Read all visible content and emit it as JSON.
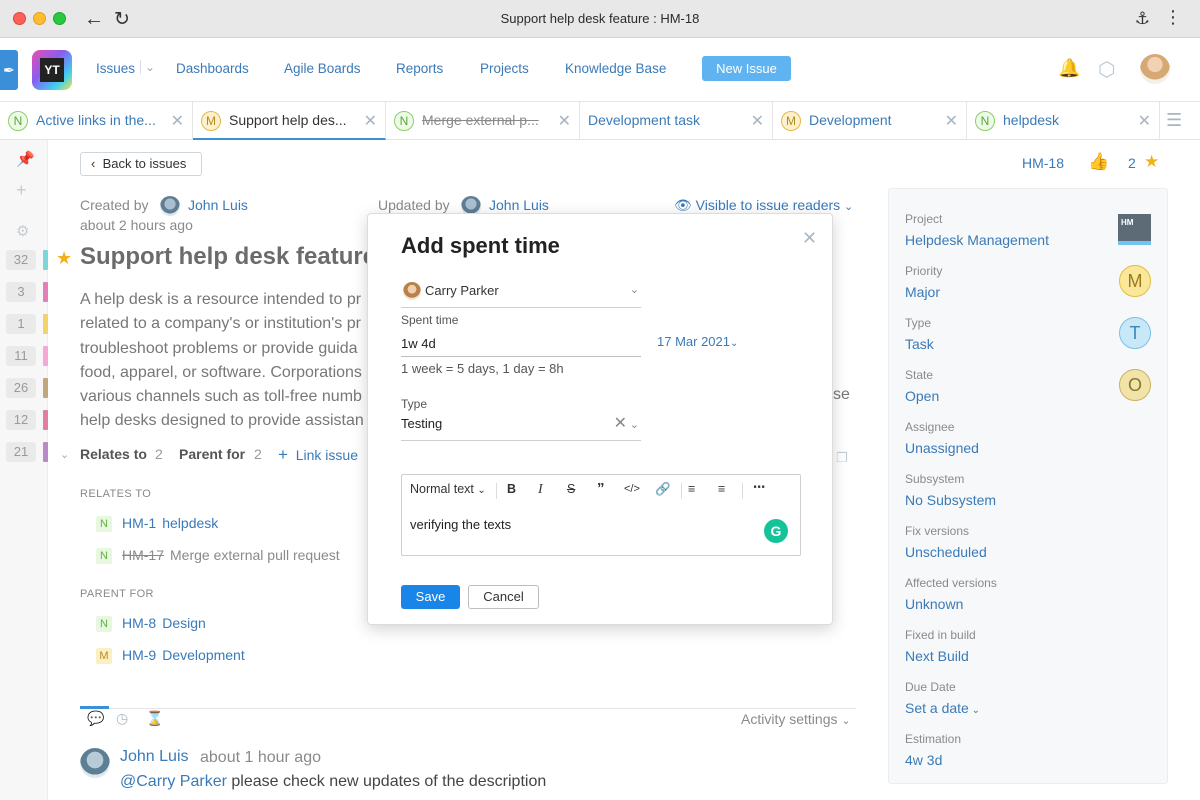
{
  "window": {
    "title": "Support help desk feature : HM-18"
  },
  "nav": {
    "logo": "YT",
    "items": [
      "Issues",
      "Dashboards",
      "Agile Boards",
      "Reports",
      "Projects",
      "Knowledge Base"
    ],
    "new_issue": "New Issue"
  },
  "tabs": [
    {
      "badge": "N",
      "label": "Active links in the..."
    },
    {
      "badge": "M",
      "label": "Support help des..."
    },
    {
      "badge": "N",
      "label": "Merge external p..."
    },
    {
      "badge": "",
      "label": "Development task"
    },
    {
      "badge": "M",
      "label": "Development"
    },
    {
      "badge": "N",
      "label": "helpdesk"
    }
  ],
  "sidebar": {
    "counts": [
      "32",
      "3",
      "1",
      "11",
      "26",
      "12",
      "21"
    ],
    "bar_colors": [
      "#7fd6d8",
      "#e27fb8",
      "#f2d36a",
      "#f5a8d8",
      "#c2a77d",
      "#e27fa0",
      "#b98ac8"
    ]
  },
  "issue": {
    "back": "Back to issues",
    "created_label": "Created by",
    "created_by": "John Luis",
    "created_time": "about 2 hours ago",
    "updated_label": "Updated by",
    "updated_by": "John Luis",
    "visibility": "Visible to issue readers",
    "title": "Support help desk feature",
    "description_lines": [
      "A help desk is a resource intended to pr",
      "related to a company's or institution's pr",
      "troubleshoot problems or provide guida",
      "food, apparel, or software. Corporations",
      "various channels such as toll-free numb",
      "help desks designed to provide assistan"
    ],
    "description_tail": "se",
    "id": "HM-18",
    "votes": "2"
  },
  "relations": {
    "relates_label": "Relates to",
    "relates_count": "2",
    "parent_label": "Parent for",
    "parent_count": "2",
    "link_issue": "Link issue",
    "relates_head": "RELATES TO",
    "relates_items": [
      {
        "badge": "N",
        "id": "HM-1",
        "name": "helpdesk"
      },
      {
        "badge": "N",
        "id": "HM-17",
        "name": "Merge external pull request"
      }
    ],
    "parent_head": "PARENT FOR",
    "parent_items": [
      {
        "badge": "N",
        "id": "HM-8",
        "name": "Design"
      },
      {
        "badge": "M",
        "id": "HM-9",
        "name": "Development"
      }
    ]
  },
  "activity": {
    "settings": "Activity settings",
    "comment_author": "John Luis",
    "comment_time": "about 1 hour ago",
    "mention": "@Carry Parker",
    "comment_text": " please check new updates of the description"
  },
  "fields": [
    {
      "label": "Project",
      "value": "Helpdesk Management",
      "icon": "HM"
    },
    {
      "label": "Priority",
      "value": "Major",
      "circle": "M"
    },
    {
      "label": "Type",
      "value": "Task",
      "circle": "T"
    },
    {
      "label": "State",
      "value": "Open",
      "circle": "O"
    },
    {
      "label": "Assignee",
      "value": "Unassigned"
    },
    {
      "label": "Subsystem",
      "value": "No Subsystem"
    },
    {
      "label": "Fix versions",
      "value": "Unscheduled"
    },
    {
      "label": "Affected versions",
      "value": "Unknown"
    },
    {
      "label": "Fixed in build",
      "value": "Next Build"
    },
    {
      "label": "Due Date",
      "value": "Set a date"
    },
    {
      "label": "Estimation",
      "value": "4w 3d"
    }
  ],
  "modal": {
    "title": "Add spent time",
    "user": "Carry Parker",
    "spent_label": "Spent time",
    "spent_value": "1w 4d",
    "hint": "1 week = 5 days, 1 day = 8h",
    "date": "17 Mar 2021",
    "type_label": "Type",
    "type_value": "Testing",
    "format": "Normal text",
    "editor_text": "verifying the texts",
    "save": "Save",
    "cancel": "Cancel"
  }
}
